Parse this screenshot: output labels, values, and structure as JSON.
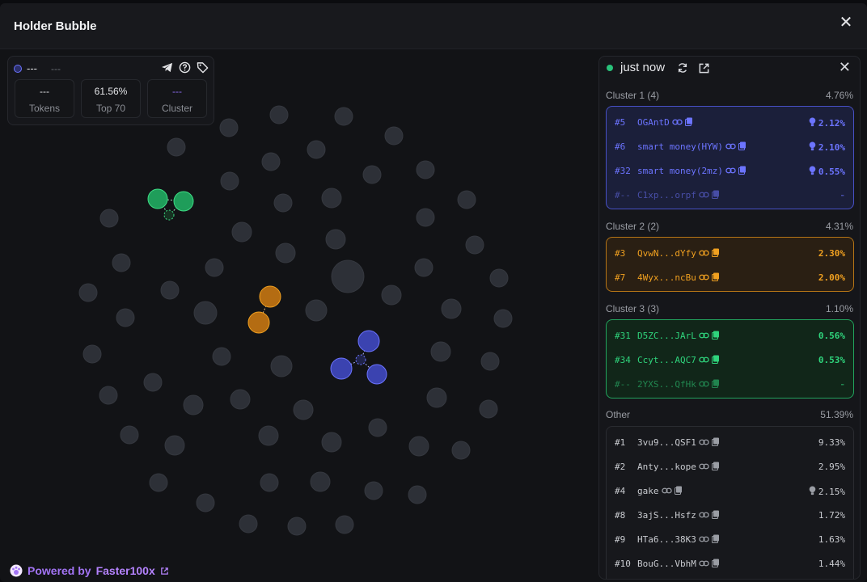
{
  "window": {
    "title": "Holder Bubble",
    "close_label": "✕"
  },
  "info": {
    "name": "---",
    "sub": "---",
    "stats": [
      {
        "value": "---",
        "label": "Tokens"
      },
      {
        "value": "61.56%",
        "label": "Top 70"
      },
      {
        "value": "---",
        "label": "Cluster"
      }
    ]
  },
  "footer": {
    "prefix": "Powered by",
    "brand": "Faster100x"
  },
  "panel": {
    "time": "just now",
    "clusters": [
      {
        "title": "Cluster 1 (4)",
        "pct": "4.76%",
        "color": "#6c74ff",
        "rows": [
          {
            "rank": "#5",
            "name": "OGAntD",
            "pct": "2.12%",
            "bulb": true,
            "dim": false
          },
          {
            "rank": "#6",
            "name": "smart money(HYW)",
            "pct": "2.10%",
            "bulb": true,
            "dim": false
          },
          {
            "rank": "#32",
            "name": "smart money(2mz)",
            "pct": "0.55%",
            "bulb": true,
            "dim": false
          },
          {
            "rank": "#--",
            "name": "C1xp...orpf",
            "pct": "-",
            "bulb": false,
            "dim": true
          }
        ]
      },
      {
        "title": "Cluster 2 (2)",
        "pct": "4.31%",
        "color": "#f0a020",
        "rows": [
          {
            "rank": "#3",
            "name": "QvwN...dYfy",
            "pct": "2.30%",
            "bulb": false,
            "dim": false
          },
          {
            "rank": "#7",
            "name": "4Wyx...ncBu",
            "pct": "2.00%",
            "bulb": false,
            "dim": false
          }
        ]
      },
      {
        "title": "Cluster 3 (3)",
        "pct": "1.10%",
        "color": "#2fd47c",
        "rows": [
          {
            "rank": "#31",
            "name": "D5ZC...JArL",
            "pct": "0.56%",
            "bulb": false,
            "dim": false
          },
          {
            "rank": "#34",
            "name": "Ccyt...AQC7",
            "pct": "0.53%",
            "bulb": false,
            "dim": false
          },
          {
            "rank": "#--",
            "name": "2YXS...QfHk",
            "pct": "-",
            "bulb": false,
            "dim": true
          }
        ]
      }
    ],
    "other": {
      "title": "Other",
      "pct": "51.39%",
      "color": "#c9cbd0",
      "rows": [
        {
          "rank": "#1",
          "name": "3vu9...QSF1",
          "pct": "9.33%",
          "bulb": false
        },
        {
          "rank": "#2",
          "name": "Anty...kope",
          "pct": "2.95%",
          "bulb": false
        },
        {
          "rank": "#4",
          "name": "gake",
          "pct": "2.15%",
          "bulb": true
        },
        {
          "rank": "#8",
          "name": "3ajS...Hsfz",
          "pct": "1.72%",
          "bulb": false
        },
        {
          "rank": "#9",
          "name": "HTa6...38K3",
          "pct": "1.63%",
          "bulb": false
        },
        {
          "rank": "#10",
          "name": "BouG...VbhM",
          "pct": "1.44%",
          "bulb": false
        }
      ]
    }
  }
}
